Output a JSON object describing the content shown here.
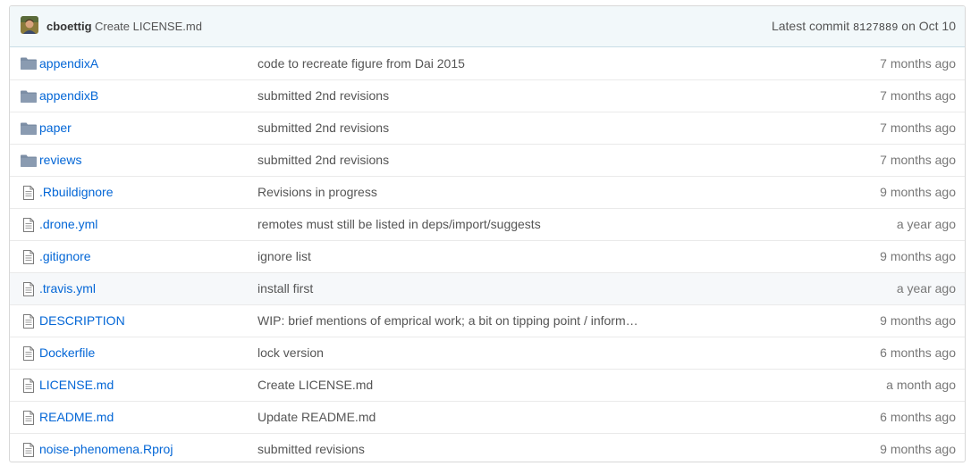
{
  "commit": {
    "author": "cboettig",
    "message": "Create LICENSE.md",
    "latest_prefix": "Latest commit",
    "sha": "8127889",
    "date": "on Oct 10"
  },
  "files": [
    {
      "type": "dir",
      "icon": "folder-icon",
      "name": "appendixA",
      "message": "code to recreate figure from Dai 2015",
      "age": "7 months ago"
    },
    {
      "type": "dir",
      "icon": "folder-icon",
      "name": "appendixB",
      "message": "submitted 2nd revisions",
      "age": "7 months ago"
    },
    {
      "type": "dir",
      "icon": "folder-icon",
      "name": "paper",
      "message": "submitted 2nd revisions",
      "age": "7 months ago"
    },
    {
      "type": "dir",
      "icon": "folder-icon",
      "name": "reviews",
      "message": "submitted 2nd revisions",
      "age": "7 months ago"
    },
    {
      "type": "file",
      "icon": "file-icon",
      "name": ".Rbuildignore",
      "message": "Revisions in progress",
      "age": "9 months ago"
    },
    {
      "type": "file",
      "icon": "file-icon",
      "name": ".drone.yml",
      "message": "remotes must still be listed in deps/import/suggests",
      "age": "a year ago"
    },
    {
      "type": "file",
      "icon": "file-icon",
      "name": ".gitignore",
      "message": "ignore list",
      "age": "9 months ago"
    },
    {
      "type": "file",
      "icon": "file-icon",
      "name": ".travis.yml",
      "message": "install first",
      "age": "a year ago"
    },
    {
      "type": "file",
      "icon": "file-icon",
      "name": "DESCRIPTION",
      "message": "WIP: brief mentions of emprical work; a bit on tipping point / inform…",
      "age": "9 months ago"
    },
    {
      "type": "file",
      "icon": "file-icon",
      "name": "Dockerfile",
      "message": "lock version",
      "age": "6 months ago"
    },
    {
      "type": "file",
      "icon": "file-icon",
      "name": "LICENSE.md",
      "message": "Create LICENSE.md",
      "age": "a month ago"
    },
    {
      "type": "file",
      "icon": "file-icon",
      "name": "README.md",
      "message": "Update README.md",
      "age": "6 months ago"
    },
    {
      "type": "file",
      "icon": "file-icon",
      "name": "noise-phenomena.Rproj",
      "message": "submitted revisions",
      "age": "9 months ago"
    }
  ],
  "colors": {
    "link": "#0366d6",
    "folder": "#79b8ff",
    "file_icon": "#6a737d",
    "header_bg": "#f2f8fa"
  }
}
